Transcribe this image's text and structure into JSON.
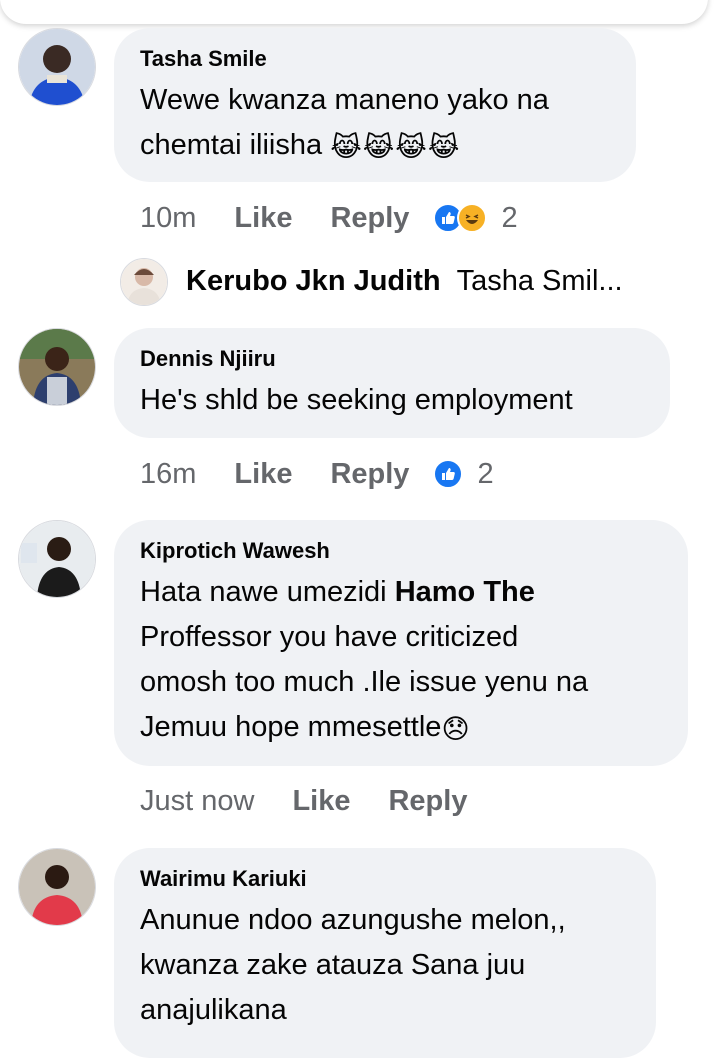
{
  "comments": [
    {
      "author": "Tasha Smile",
      "lines": [
        "Wewe kwanza maneno yako na",
        "chemtai iliisha"
      ],
      "emoji": "😹😹😹😹",
      "time": "10m",
      "like_label": "Like",
      "reply_label": "Reply",
      "reaction_count": "2",
      "reactions": [
        "like-icon",
        "haha-icon"
      ]
    },
    {
      "author": "Dennis Njiiru",
      "lines": [
        "He's shld be seeking employment"
      ],
      "time": "16m",
      "like_label": "Like",
      "reply_label": "Reply",
      "reaction_count": "2",
      "reactions": [
        "like-icon"
      ]
    },
    {
      "author": "Kiprotich Wawesh",
      "line1_prefix": "Hata nawe umezidi ",
      "mention": "Hamo The",
      "lines_rest": [
        "Proffessor you have criticized",
        "omosh too much .Ile issue yenu na",
        "Jemuu hope mmesettle"
      ],
      "emoji": "😞",
      "time": "Just now",
      "like_label": "Like",
      "reply_label": "Reply"
    },
    {
      "author": "Wairimu Kariuki",
      "lines": [
        "Anunue ndoo azungushe melon,,",
        "kwanza zake atauza Sana juu",
        "anajulikana"
      ]
    }
  ],
  "reply_preview": {
    "author": "Kerubo Jkn Judith",
    "text": "Tasha Smil..."
  },
  "colors": {
    "bubble": "#f0f2f5",
    "meta_text": "#65676b",
    "like_blue": "#1877f2",
    "haha_yellow": "#f7b125"
  }
}
